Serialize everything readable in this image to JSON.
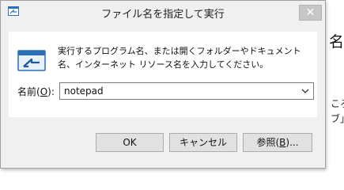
{
  "background": {
    "heading_fragment": "名を",
    "line1_fragment": "ころ",
    "line2_fragment": "ブ」"
  },
  "dialog": {
    "title": "ファイル名を指定して実行",
    "close_label": "✕",
    "description": "実行するプログラム名、または開くフォルダーやドキュメント名、インターネット リソース名を入力してください。",
    "open_label_prefix": "名前(",
    "open_label_mnemonic": "O",
    "open_label_suffix": "):",
    "input_value": "notepad",
    "buttons": {
      "ok": "OK",
      "cancel": "キャンセル",
      "browse_prefix": "参照(",
      "browse_mnemonic": "B",
      "browse_suffix": ")..."
    }
  },
  "colors": {
    "dialog_bg": "#f0f0f0",
    "content_bg": "#ffffff",
    "close_button_bg": "#c7c7c7",
    "icon_blue": "#2a6fb8"
  },
  "icons": {
    "title": "run-window-icon",
    "main": "run-window-icon",
    "dropdown": "chevron-down-icon",
    "close": "close-icon"
  }
}
